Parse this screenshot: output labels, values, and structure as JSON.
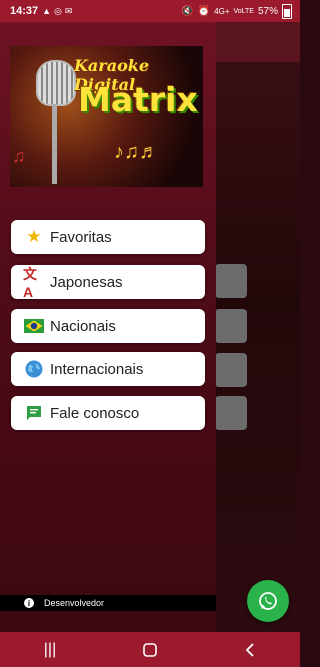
{
  "status_bar": {
    "time": "14:37",
    "left_icons": [
      "gallery-icon",
      "instagram-icon",
      "mail-icon"
    ],
    "right_icons": [
      "mute-icon",
      "alarm-icon",
      "signal-4g-icon",
      "volte-icon"
    ],
    "battery": "57%",
    "battery_level": 0.57
  },
  "drawer": {
    "logo": {
      "line1": "Karaoke Digital",
      "line2": "Matrix"
    },
    "menu": [
      {
        "label": "Favoritas",
        "icon": "star-icon"
      },
      {
        "label": "Japonesas",
        "icon": "translate-icon"
      },
      {
        "label": "Nacionais",
        "icon": "brazil-flag-icon"
      },
      {
        "label": "Internacionais",
        "icon": "globe-icon"
      },
      {
        "label": "Fale conosco",
        "icon": "chat-icon"
      }
    ],
    "footer": {
      "label": "Desenvolvedor",
      "icon": "info-icon"
    }
  },
  "fab": {
    "icon": "whatsapp-icon"
  },
  "nav_bar": {
    "items": [
      "recents-icon",
      "home-icon",
      "back-icon"
    ]
  },
  "colors": {
    "primary": "#9b1a2e",
    "drawer_top": "#6e1224",
    "drawer_bottom": "#3c0711",
    "fab": "#2ab34a",
    "logo_text": "#ffe23a"
  }
}
